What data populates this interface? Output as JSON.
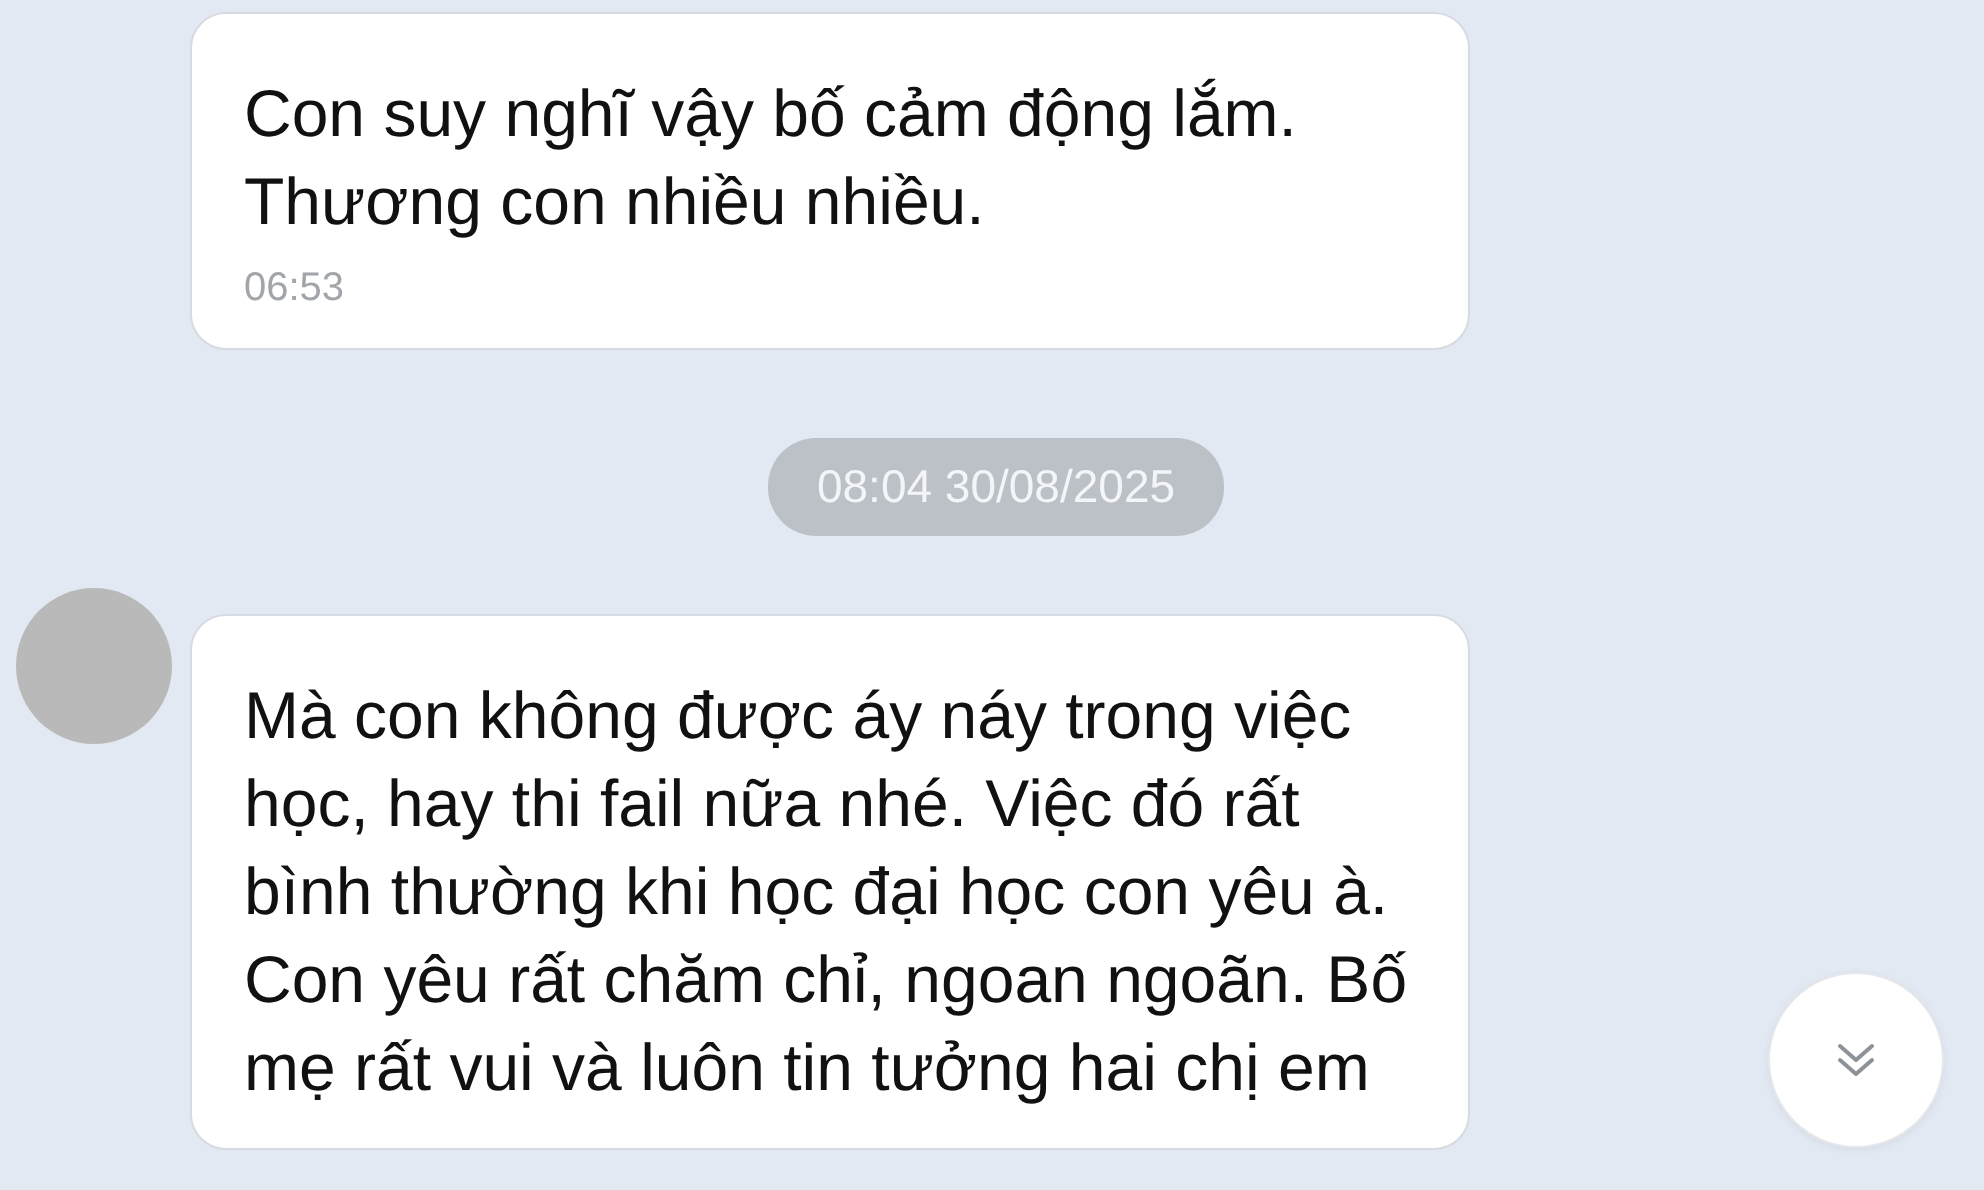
{
  "messages": [
    {
      "kind": "message",
      "avatar": false,
      "lines": [
        "Con suy nghĩ vậy bố cảm động lắm.",
        "Thương con nhiều nhiều."
      ],
      "time": "06:53"
    },
    {
      "kind": "date",
      "text": "08:04 30/08/2025"
    },
    {
      "kind": "message",
      "avatar": true,
      "lines": [
        "Mà con không được áy náy trong việc",
        "học, hay thi fail nữa nhé. Việc đó rất",
        "bình thường khi học đại học con yêu à.",
        "Con yêu rất chăm chỉ, ngoan ngoãn. Bố",
        "mẹ rất vui và luôn tin tưởng hai chị em"
      ]
    }
  ],
  "scroll_button": {
    "shown": true
  }
}
